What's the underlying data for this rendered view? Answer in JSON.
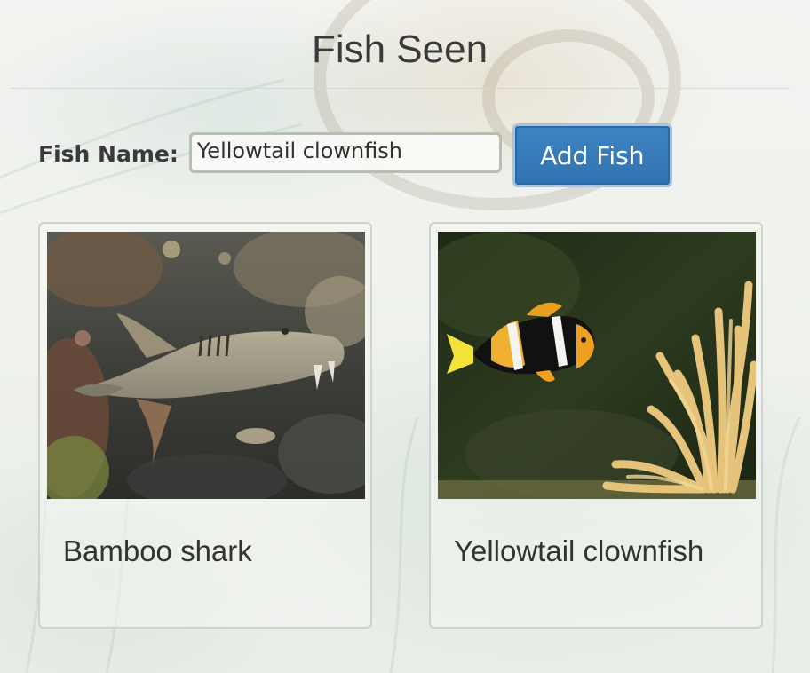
{
  "header": {
    "title": "Fish Seen"
  },
  "form": {
    "label": "Fish Name:",
    "input_value": "Yellowtail clownfish",
    "button_label": "Add Fish"
  },
  "fish": [
    {
      "name": "Bamboo shark",
      "photo": "bamboo-shark-photo"
    },
    {
      "name": "Yellowtail clownfish",
      "photo": "yellowtail-clownfish-photo"
    }
  ],
  "colors": {
    "accent_button": "#2f73b1",
    "page_text": "#333333"
  }
}
